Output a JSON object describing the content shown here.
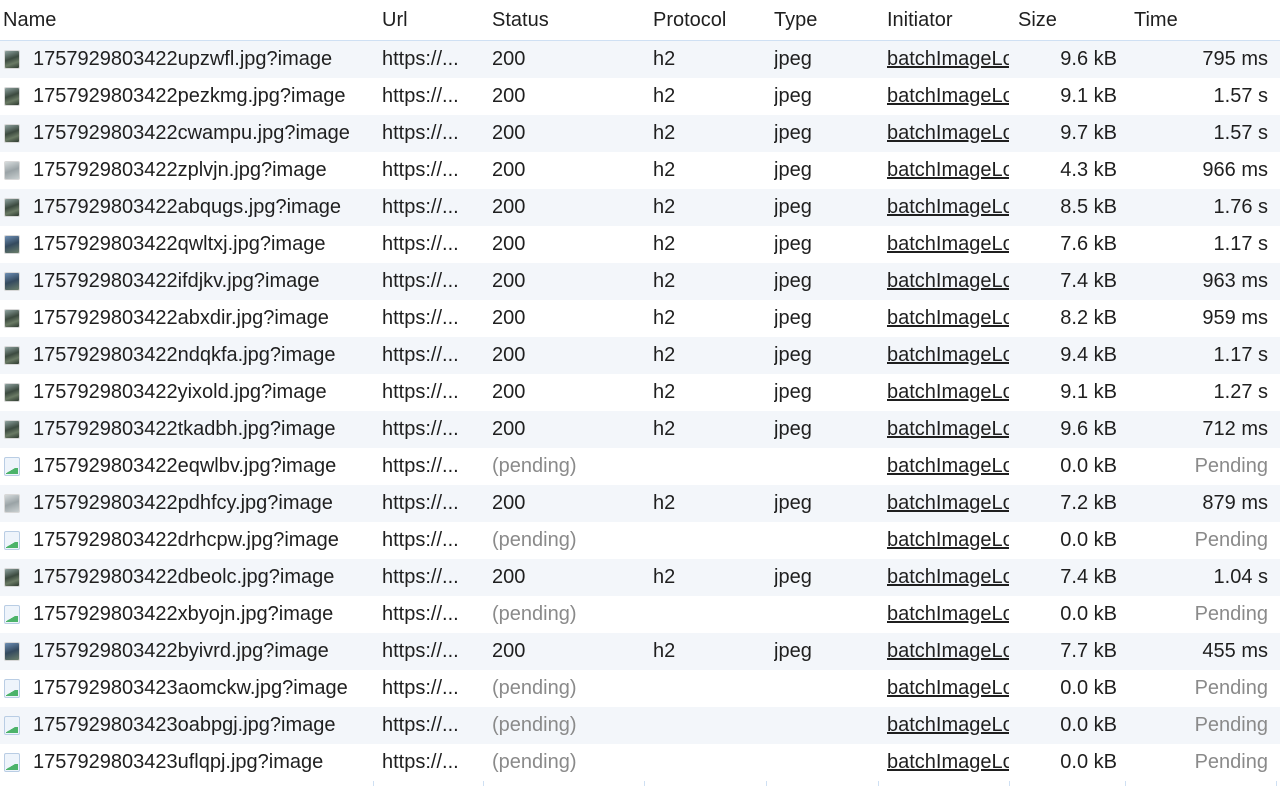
{
  "headers": {
    "name": "Name",
    "url": "Url",
    "status": "Status",
    "protocol": "Protocol",
    "type": "Type",
    "initiator": "Initiator",
    "size": "Size",
    "time": "Time"
  },
  "rows": [
    {
      "name": "1757929803422upzwfl.jpg?image",
      "url": "https://...",
      "status": "200",
      "protocol": "h2",
      "type": "jpeg",
      "initiator": "batchImageLoad",
      "size": "9.6 kB",
      "time": "795 ms",
      "icon": "image-thumbnail-icon",
      "pending": false
    },
    {
      "name": "1757929803422pezkmg.jpg?image",
      "url": "https://...",
      "status": "200",
      "protocol": "h2",
      "type": "jpeg",
      "initiator": "batchImageLoad",
      "size": "9.1 kB",
      "time": "1.57 s",
      "icon": "image-thumbnail-icon",
      "pending": false
    },
    {
      "name": "1757929803422cwampu.jpg?image",
      "url": "https://...",
      "status": "200",
      "protocol": "h2",
      "type": "jpeg",
      "initiator": "batchImageLoad",
      "size": "9.7 kB",
      "time": "1.57 s",
      "icon": "image-thumbnail-icon",
      "pending": false
    },
    {
      "name": "1757929803422zplvjn.jpg?image",
      "url": "https://...",
      "status": "200",
      "protocol": "h2",
      "type": "jpeg",
      "initiator": "batchImageLoad",
      "size": "4.3 kB",
      "time": "966 ms",
      "icon": "image-thumbnail-icon",
      "pending": false,
      "light": true
    },
    {
      "name": "1757929803422abqugs.jpg?image",
      "url": "https://...",
      "status": "200",
      "protocol": "h2",
      "type": "jpeg",
      "initiator": "batchImageLoad",
      "size": "8.5 kB",
      "time": "1.76 s",
      "icon": "image-thumbnail-icon",
      "pending": false
    },
    {
      "name": "1757929803422qwltxj.jpg?image",
      "url": "https://...",
      "status": "200",
      "protocol": "h2",
      "type": "jpeg",
      "initiator": "batchImageLoad",
      "size": "7.6 kB",
      "time": "1.17 s",
      "icon": "image-thumbnail-icon",
      "pending": false,
      "blue": true
    },
    {
      "name": "1757929803422ifdjkv.jpg?image",
      "url": "https://...",
      "status": "200",
      "protocol": "h2",
      "type": "jpeg",
      "initiator": "batchImageLoad",
      "size": "7.4 kB",
      "time": "963 ms",
      "icon": "image-thumbnail-icon",
      "pending": false,
      "blue": true
    },
    {
      "name": "1757929803422abxdir.jpg?image",
      "url": "https://...",
      "status": "200",
      "protocol": "h2",
      "type": "jpeg",
      "initiator": "batchImageLoad",
      "size": "8.2 kB",
      "time": "959 ms",
      "icon": "image-thumbnail-icon",
      "pending": false
    },
    {
      "name": "1757929803422ndqkfa.jpg?image",
      "url": "https://...",
      "status": "200",
      "protocol": "h2",
      "type": "jpeg",
      "initiator": "batchImageLoad",
      "size": "9.4 kB",
      "time": "1.17 s",
      "icon": "image-thumbnail-icon",
      "pending": false
    },
    {
      "name": "1757929803422yixold.jpg?image",
      "url": "https://...",
      "status": "200",
      "protocol": "h2",
      "type": "jpeg",
      "initiator": "batchImageLoad",
      "size": "9.1 kB",
      "time": "1.27 s",
      "icon": "image-thumbnail-icon",
      "pending": false
    },
    {
      "name": "1757929803422tkadbh.jpg?image",
      "url": "https://...",
      "status": "200",
      "protocol": "h2",
      "type": "jpeg",
      "initiator": "batchImageLoad",
      "size": "9.6 kB",
      "time": "712 ms",
      "icon": "image-thumbnail-icon",
      "pending": false
    },
    {
      "name": "1757929803422eqwlbv.jpg?image",
      "url": "https://...",
      "status": "(pending)",
      "protocol": "",
      "type": "",
      "initiator": "batchImageLoad",
      "size": "0.0 kB",
      "time": "Pending",
      "icon": "image-placeholder-icon",
      "pending": true
    },
    {
      "name": "1757929803422pdhfcy.jpg?image",
      "url": "https://...",
      "status": "200",
      "protocol": "h2",
      "type": "jpeg",
      "initiator": "batchImageLoad",
      "size": "7.2 kB",
      "time": "879 ms",
      "icon": "image-thumbnail-icon",
      "pending": false,
      "light": true
    },
    {
      "name": "1757929803422drhcpw.jpg?image",
      "url": "https://...",
      "status": "(pending)",
      "protocol": "",
      "type": "",
      "initiator": "batchImageLoad",
      "size": "0.0 kB",
      "time": "Pending",
      "icon": "image-placeholder-icon",
      "pending": true
    },
    {
      "name": "1757929803422dbeolc.jpg?image",
      "url": "https://...",
      "status": "200",
      "protocol": "h2",
      "type": "jpeg",
      "initiator": "batchImageLoad",
      "size": "7.4 kB",
      "time": "1.04 s",
      "icon": "image-thumbnail-icon",
      "pending": false
    },
    {
      "name": "1757929803422xbyojn.jpg?image",
      "url": "https://...",
      "status": "(pending)",
      "protocol": "",
      "type": "",
      "initiator": "batchImageLoad",
      "size": "0.0 kB",
      "time": "Pending",
      "icon": "image-placeholder-icon",
      "pending": true
    },
    {
      "name": "1757929803422byivrd.jpg?image",
      "url": "https://...",
      "status": "200",
      "protocol": "h2",
      "type": "jpeg",
      "initiator": "batchImageLoad",
      "size": "7.7 kB",
      "time": "455 ms",
      "icon": "image-thumbnail-icon",
      "pending": false,
      "blue": true
    },
    {
      "name": "1757929803423aomckw.jpg?image",
      "url": "https://...",
      "status": "(pending)",
      "protocol": "",
      "type": "",
      "initiator": "batchImageLoad",
      "size": "0.0 kB",
      "time": "Pending",
      "icon": "image-placeholder-icon",
      "pending": true
    },
    {
      "name": "1757929803423oabpgj.jpg?image",
      "url": "https://...",
      "status": "(pending)",
      "protocol": "",
      "type": "",
      "initiator": "batchImageLoad",
      "size": "0.0 kB",
      "time": "Pending",
      "icon": "image-placeholder-icon",
      "pending": true
    },
    {
      "name": "1757929803423uflqpj.jpg?image",
      "url": "https://...",
      "status": "(pending)",
      "protocol": "",
      "type": "",
      "initiator": "batchImageLoad",
      "size": "0.0 kB",
      "time": "Pending",
      "icon": "image-placeholder-icon",
      "pending": true
    }
  ]
}
